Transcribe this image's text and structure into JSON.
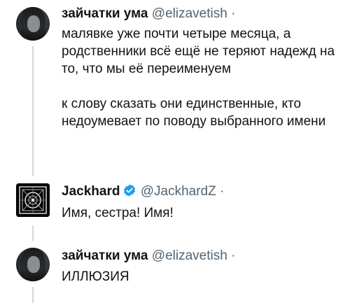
{
  "tweets": [
    {
      "name": "зайчатки ума",
      "handle": "@elizavetish",
      "separator": "·",
      "text": "малявке уже почти четыре месяца, а родственники всё ещё не теряют надежд на то, что мы её переименуем\n\nк слову сказать они единственные, кто недоумевает по поводу выбранного имени",
      "avatar_icon": "user-avatar-photo"
    },
    {
      "name": "Jackhard",
      "handle": "@JackhardZ",
      "separator": "·",
      "text": "Имя, сестра! Имя!",
      "verified": true,
      "avatar_icon": "ornamental-emblem-avatar"
    },
    {
      "name": "зайчатки ума",
      "handle": "@elizavetish",
      "separator": "·",
      "text": "ИЛЛЮЗИЯ",
      "avatar_icon": "user-avatar-photo"
    }
  ],
  "colors": {
    "text": "#0f1419",
    "secondary": "#536471",
    "thread_line": "#cfd9de",
    "verified_badge": "#1d9bf0"
  }
}
